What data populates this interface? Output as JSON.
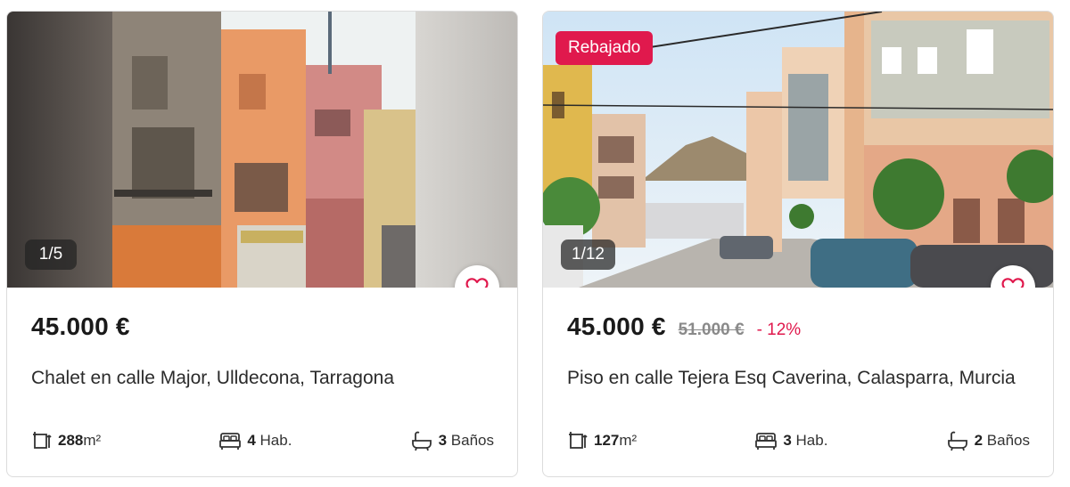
{
  "listings": [
    {
      "image_counter": "1/5",
      "badge": "",
      "price": "45.000 €",
      "old_price": "",
      "discount": "",
      "title": "Chalet en calle Major, Ulldecona, Tarragona",
      "area_value": "288",
      "area_unit": "m²",
      "rooms_value": "4",
      "rooms_unit": "Hab.",
      "baths_value": "3",
      "baths_unit": "Baños",
      "favorite_icon": "heart-outline-icon"
    },
    {
      "image_counter": "1/12",
      "badge": "Rebajado",
      "price": "45.000 €",
      "old_price": "51.000 €",
      "discount": "- 12%",
      "title": "Piso en calle Tejera Esq Caverina, Calasparra, Murcia",
      "area_value": "127",
      "area_unit": "m²",
      "rooms_value": "3",
      "rooms_unit": "Hab.",
      "baths_value": "2",
      "baths_unit": "Baños",
      "favorite_icon": "heart-outline-icon"
    }
  ],
  "colors": {
    "accent": "#e0194d",
    "text": "#222222",
    "muted": "#8a8a8a",
    "border": "#dcdcdc"
  }
}
